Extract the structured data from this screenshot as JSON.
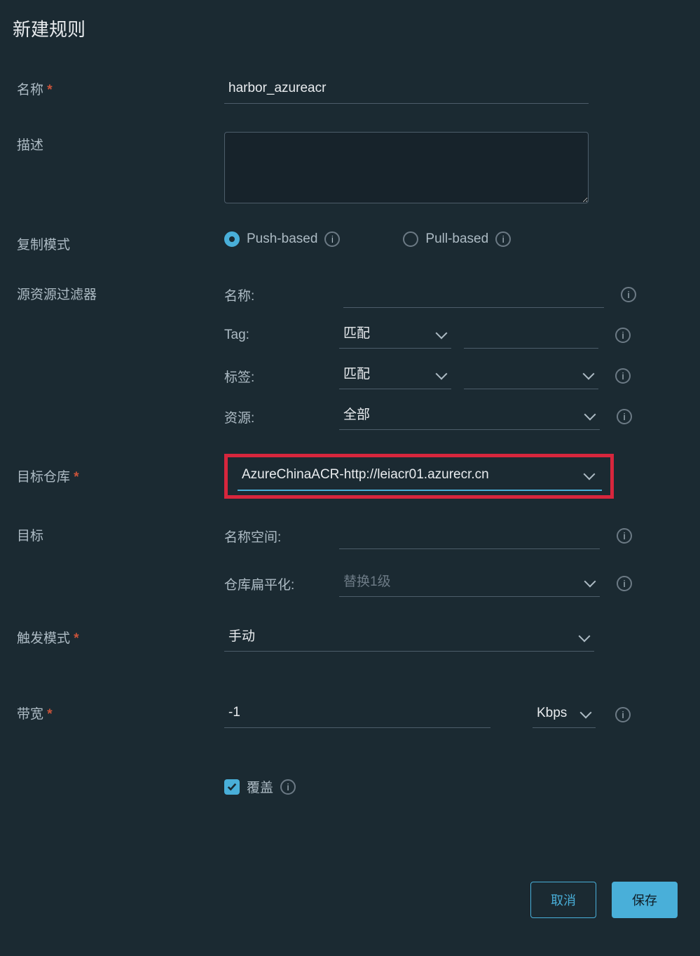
{
  "title": "新建规则",
  "labels": {
    "name": "名称",
    "description": "描述",
    "replicationMode": "复制模式",
    "sourceFilter": "源资源过滤器",
    "targetRegistry": "目标仓库",
    "target": "目标",
    "triggerMode": "触发模式",
    "bandwidth": "带宽",
    "override": "覆盖"
  },
  "fields": {
    "nameValue": "harbor_azureacr",
    "descriptionValue": "",
    "pushBased": "Push-based",
    "pullBased": "Pull-based",
    "filter": {
      "nameLabel": "名称:",
      "tagLabel": "Tag:",
      "labelLabel": "标签:",
      "resourceLabel": "资源:",
      "matchOption": "匹配",
      "allOption": "全部"
    },
    "registryValue": "AzureChinaACR-http://leiacr01.azurecr.cn",
    "namespaceLabel": "名称空间:",
    "flattenLabel": "仓库扁平化:",
    "flattenPlaceholder": "替换1级",
    "triggerValue": "手动",
    "bandwidthValue": "-1",
    "bandwidthUnit": "Kbps"
  },
  "buttons": {
    "cancel": "取消",
    "save": "保存"
  }
}
